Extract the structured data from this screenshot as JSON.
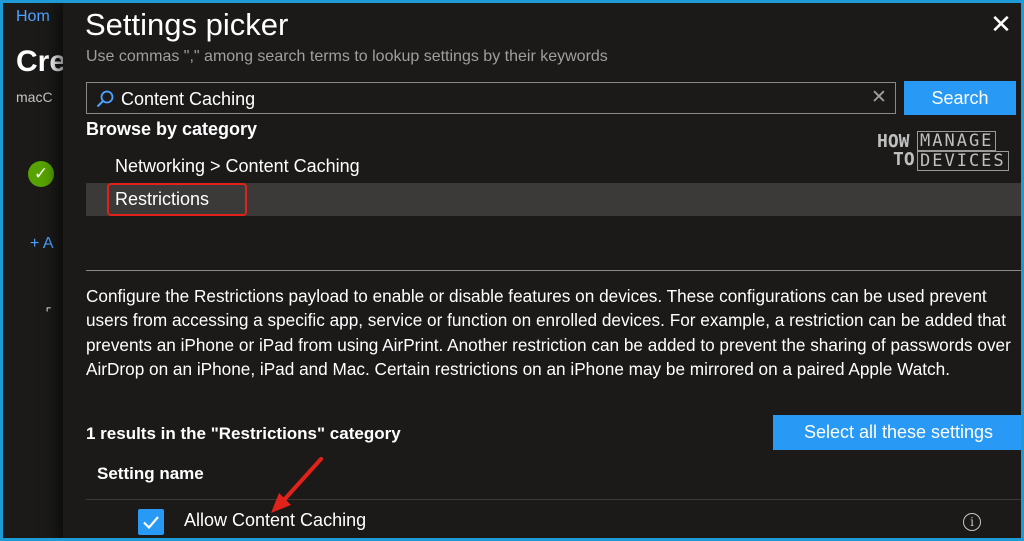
{
  "background_blade": {
    "breadcrumb": "Hom",
    "title": "Cre",
    "subtitle": "macC",
    "add_link": "+ A"
  },
  "panel": {
    "title": "Settings picker",
    "subtitle": "Use commas \",\" among search terms to lookup settings by their keywords",
    "search": {
      "value": "Content Caching",
      "button_label": "Search"
    },
    "browse_label": "Browse by category",
    "categories": [
      {
        "label": "Networking > Content Caching",
        "selected": false
      },
      {
        "label": "Restrictions",
        "selected": true
      }
    ],
    "description": "Configure the Restrictions payload to enable or disable features on devices. These configurations can be used prevent users from accessing a specific app, service or function on enrolled devices. For example, a restriction can be added that prevents an iPhone or iPad from using AirPrint. Another restriction can be added to prevent the sharing of passwords over AirDrop on an iPhone, iPad and Mac. Certain restrictions on an iPhone may be mirrored on a paired Apple Watch.",
    "results_label": "1 results in the \"Restrictions\" category",
    "select_all_label": "Select all these settings",
    "column_header": "Setting name",
    "settings": [
      {
        "name": "Allow Content Caching",
        "checked": true
      }
    ]
  },
  "watermark": {
    "line1": "HOW",
    "line2": "TO",
    "word1": "MANAGE",
    "word2": "DEVICES"
  },
  "colors": {
    "accent": "#2899f5",
    "highlight": "#e0221b",
    "success": "#57a300",
    "panel_bg": "#1b1a19"
  }
}
